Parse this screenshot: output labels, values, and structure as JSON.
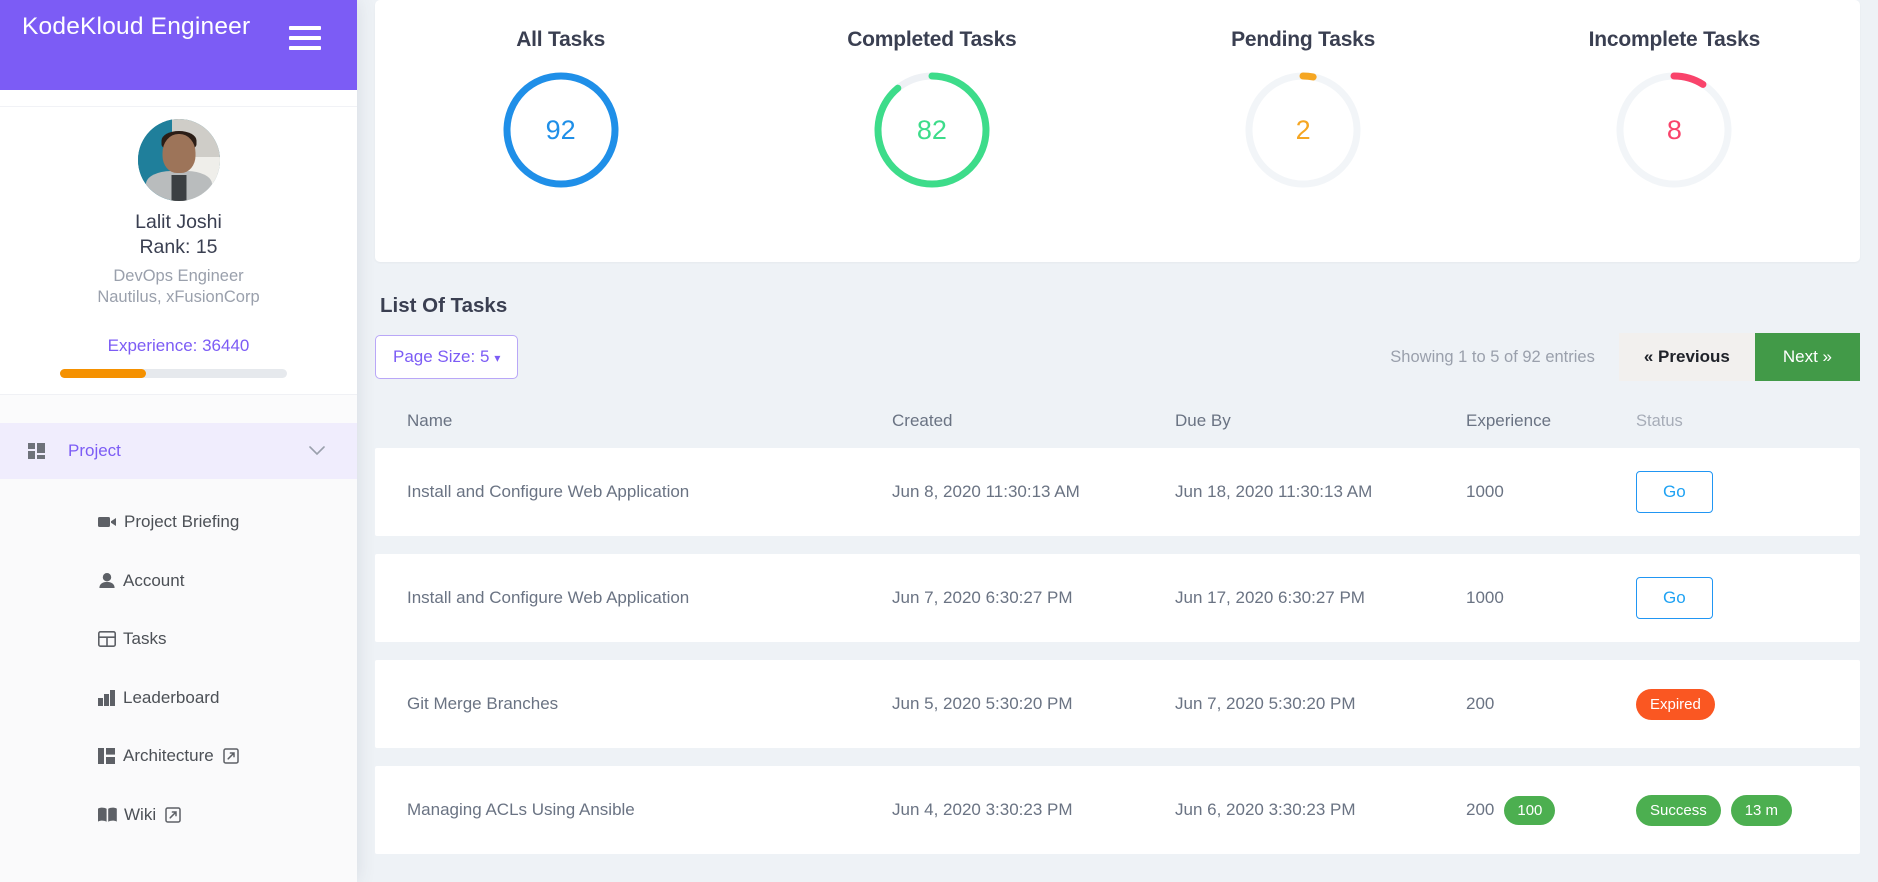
{
  "brand": {
    "title": "KodeKloud Engineer",
    "menu_icon": "hamburger-icon",
    "accent": "#7C5CF5"
  },
  "profile": {
    "name": "Lalit Joshi",
    "rank": "Rank: 15",
    "role": "DevOps Engineer",
    "org": "Nautilus, xFusionCorp",
    "experience_label": "Experience: 36440",
    "experience_percent": 38,
    "bar_color": "#f59100"
  },
  "sidebar": {
    "group": {
      "label": "Project",
      "icon": "dashboard-icon",
      "chevron": "chevron-down-icon"
    },
    "items": [
      {
        "label": "Project Briefing",
        "icon": "video-camera-icon",
        "external": false
      },
      {
        "label": "Account",
        "icon": "person-icon",
        "external": false
      },
      {
        "label": "Tasks",
        "icon": "table-grid-icon",
        "external": false
      },
      {
        "label": "Leaderboard",
        "icon": "bar-chart-icon",
        "external": false
      },
      {
        "label": "Architecture",
        "icon": "layout-icon",
        "external": true
      },
      {
        "label": "Wiki",
        "icon": "book-icon",
        "external": true
      }
    ]
  },
  "stats": [
    {
      "title": "All Tasks",
      "value": "92",
      "percent": 100,
      "color": "#1f8fe8",
      "track": "#eef1f5"
    },
    {
      "title": "Completed Tasks",
      "value": "82",
      "percent": 89,
      "color": "#3ddc8a",
      "track": "#eef1f5"
    },
    {
      "title": "Pending Tasks",
      "value": "2",
      "percent": 3,
      "color": "#f5a623",
      "track": "#f2f5f8"
    },
    {
      "title": "Incomplete Tasks",
      "value": "8",
      "percent": 9,
      "color": "#f9436b",
      "track": "#f2f5f8"
    }
  ],
  "tasks_panel": {
    "title": "List Of Tasks",
    "page_size_label": "Page Size: 5",
    "showing": "Showing 1 to 5 of 92 entries",
    "previous_label": "« Previous",
    "next_label": "Next »",
    "columns": [
      "Name",
      "Created",
      "Due By",
      "Experience",
      "Status"
    ],
    "rows": [
      {
        "name": "Install and Configure Web Application",
        "created": "Jun 8, 2020 11:30:13 AM",
        "due": "Jun 18, 2020 11:30:13 AM",
        "experience": "1000",
        "experience_badge": null,
        "status_kind": "go",
        "status_label": "Go",
        "status_extra": null
      },
      {
        "name": "Install and Configure Web Application",
        "created": "Jun 7, 2020 6:30:27 PM",
        "due": "Jun 17, 2020 6:30:27 PM",
        "experience": "1000",
        "experience_badge": null,
        "status_kind": "go",
        "status_label": "Go",
        "status_extra": null
      },
      {
        "name": "Git Merge Branches",
        "created": "Jun 5, 2020 5:30:20 PM",
        "due": "Jun 7, 2020 5:30:20 PM",
        "experience": "200",
        "experience_badge": null,
        "status_kind": "expired",
        "status_label": "Expired",
        "status_extra": null
      },
      {
        "name": "Managing ACLs Using Ansible",
        "created": "Jun 4, 2020 3:30:23 PM",
        "due": "Jun 6, 2020 3:30:23 PM",
        "experience": "200",
        "experience_badge": "100",
        "status_kind": "success",
        "status_label": "Success",
        "status_extra": "13 m"
      }
    ]
  }
}
